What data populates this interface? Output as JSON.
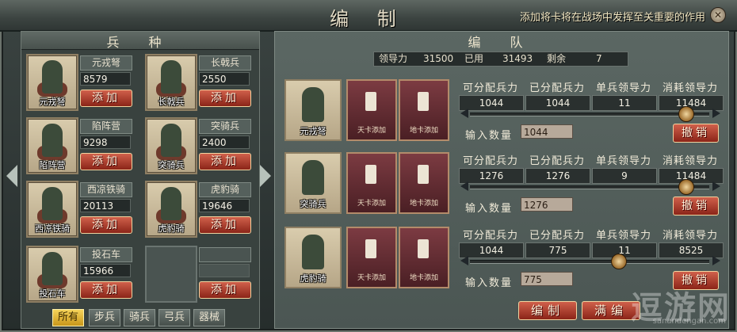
{
  "window": {
    "title": "编 制",
    "hint": "添加将卡将在战场中发挥至关重要的作用",
    "close_icon": "close-icon"
  },
  "left": {
    "title": "兵 种",
    "units": [
      {
        "name": "元戎弩",
        "count": "8579",
        "add": "添加",
        "caption": "元戎弩"
      },
      {
        "name": "长戟兵",
        "count": "2550",
        "add": "添加",
        "caption": "长戟兵"
      },
      {
        "name": "陷阵营",
        "count": "9298",
        "add": "添加",
        "caption": "陷阵营"
      },
      {
        "name": "突骑兵",
        "count": "2400",
        "add": "添加",
        "caption": "突骑兵"
      },
      {
        "name": "西凉铁骑",
        "count": "20113",
        "add": "添加",
        "caption": "西凉铁骑"
      },
      {
        "name": "虎豹骑",
        "count": "19646",
        "add": "添加",
        "caption": "虎豹骑"
      },
      {
        "name": "投石车",
        "count": "15966",
        "add": "添加",
        "caption": "投石车"
      },
      {
        "name": "",
        "count": "",
        "add": "添加",
        "caption": ""
      }
    ],
    "filters": [
      "所有",
      "步兵",
      "骑兵",
      "弓兵",
      "器械"
    ],
    "active_filter": "所有"
  },
  "right": {
    "title": "编 队",
    "summary": {
      "leadership_label": "领导力",
      "leadership": "31500",
      "used_label": "已用",
      "used": "31493",
      "remain_label": "剩余",
      "remain": "7"
    },
    "headers": [
      "可分配兵力",
      "已分配兵力",
      "单兵领导力",
      "消耗领导力"
    ],
    "input_label": "输入数量",
    "cancel_label": "撤销",
    "sky_card": "天卡添加",
    "earth_card": "地卡添加",
    "squads": [
      {
        "caption": "元戎弩",
        "values": [
          "1044",
          "1044",
          "11",
          "11484"
        ],
        "input": "1044",
        "slider": 0.9
      },
      {
        "caption": "突骑兵",
        "values": [
          "1276",
          "1276",
          "9",
          "11484"
        ],
        "input": "1276",
        "slider": 0.9
      },
      {
        "caption": "虎豹骑",
        "values": [
          "1044",
          "775",
          "11",
          "8525"
        ],
        "input": "775",
        "slider": 0.62
      }
    ],
    "buttons": {
      "compile": "编制",
      "fill": "满编"
    }
  },
  "watermark": {
    "text": "逗游网",
    "sub": "sanandengan.com"
  }
}
